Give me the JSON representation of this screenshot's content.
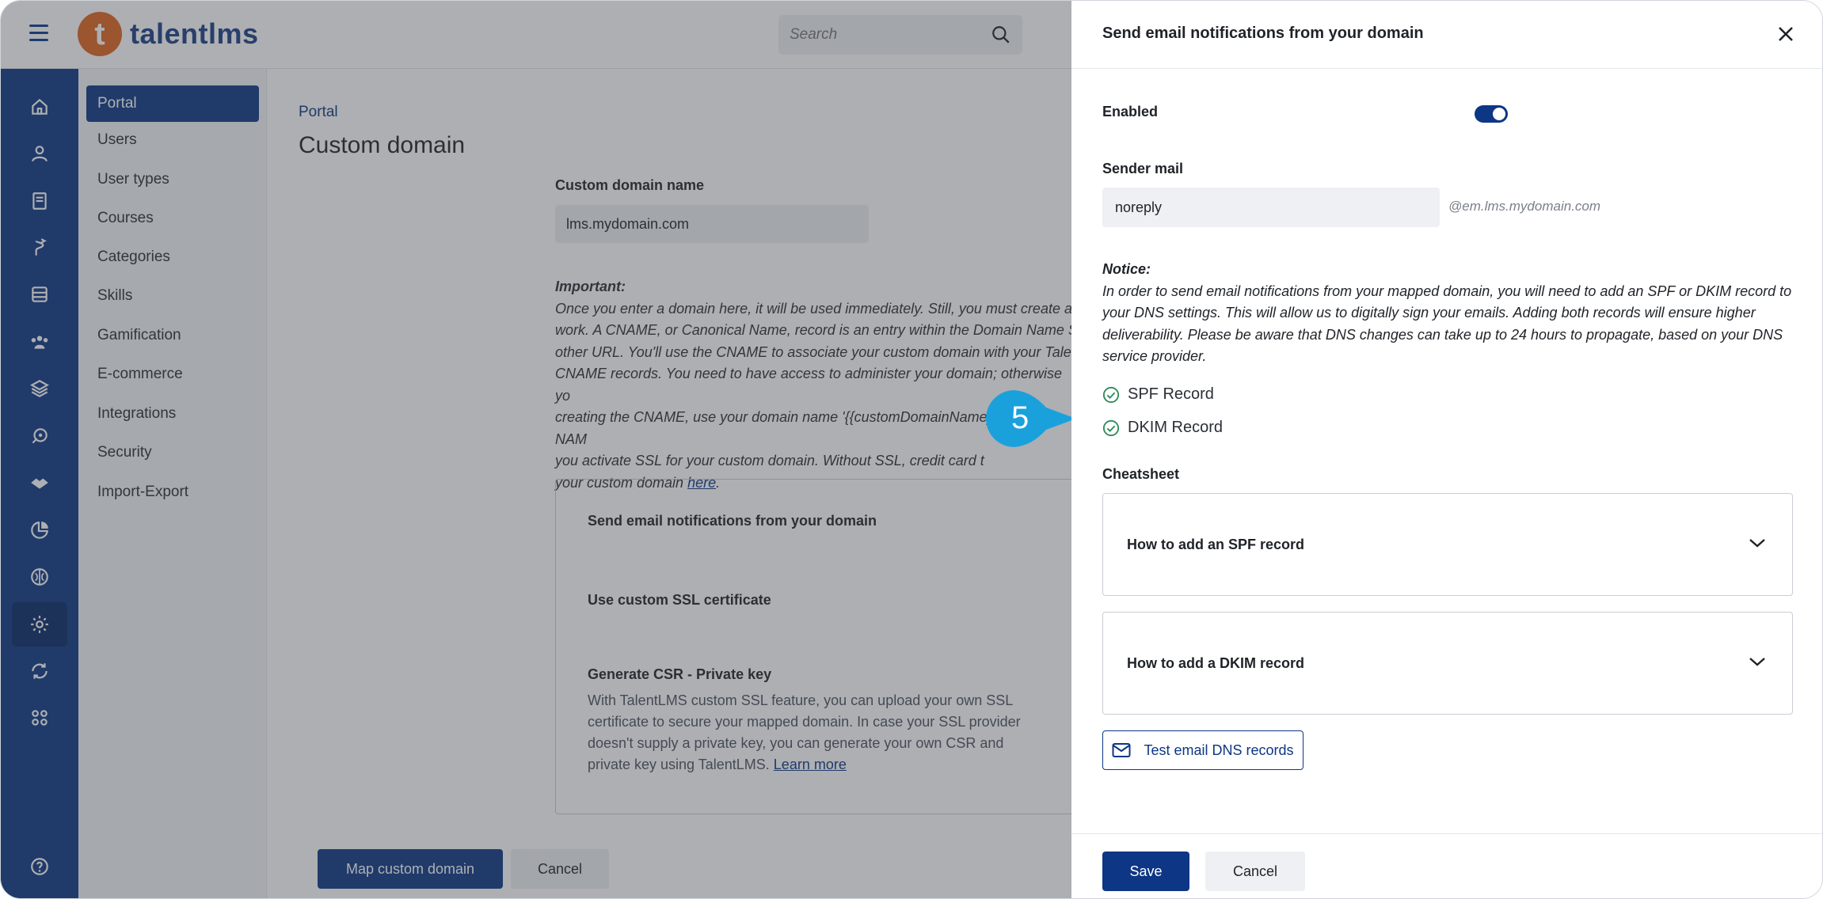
{
  "app": {
    "logo_letter": "t",
    "logo_text": "talentlms"
  },
  "search": {
    "placeholder": "Search"
  },
  "rail": {
    "icons": [
      "home-icon",
      "user-icon",
      "book-icon",
      "path-icon",
      "archive-icon",
      "users-icon",
      "layers-icon",
      "rocket-icon",
      "handshake-icon",
      "pie-chart-icon",
      "brain-icon",
      "gear-icon",
      "sync-icon",
      "apps-icon",
      "help-icon"
    ],
    "active": "gear-icon"
  },
  "subnav": {
    "items": [
      {
        "label": "Portal"
      },
      {
        "label": "Users"
      },
      {
        "label": "User types"
      },
      {
        "label": "Courses"
      },
      {
        "label": "Categories"
      },
      {
        "label": "Skills"
      },
      {
        "label": "Gamification"
      },
      {
        "label": "E-commerce"
      },
      {
        "label": "Integrations"
      },
      {
        "label": "Security"
      },
      {
        "label": "Import-Export"
      }
    ]
  },
  "main": {
    "breadcrumb": "Portal",
    "title": "Custom domain",
    "domain_label": "Custom domain name",
    "domain_value": "lms.mydomain.com",
    "important_title": "Important:",
    "important_lines": [
      "Once you enter a domain here, it will be used immediately. Still, you must create a",
      "work. A CNAME, or Canonical Name, record is an entry within the Domain Name S",
      "other URL. You'll use the CNAME to associate your custom domain with your Taler",
      "CNAME records. You need to have access to administer your domain; otherwise yo",
      "creating the CNAME, use your domain name '{{customDomainName}}' as the NAM",
      "you activate SSL for your custom domain. Without SSL, credit card t",
      "your custom domain "
    ],
    "important_link": "here",
    "card": {
      "line1": "Send email notifications from your domain",
      "line2": "Use custom SSL certificate",
      "line3": "Generate CSR - Private key",
      "desc": "With TalentLMS custom SSL feature, you can upload your own SSL certificate to secure your mapped domain. In case your SSL provider doesn't supply a private key, you can generate your own CSR and private key using TalentLMS. ",
      "desc_link": "Learn more"
    },
    "map_button": "Map custom domain",
    "cancel_button": "Cancel"
  },
  "callout": {
    "number": "5"
  },
  "drawer": {
    "title": "Send email notifications from your domain",
    "enabled_label": "Enabled",
    "enabled": true,
    "sender_label": "Sender mail",
    "sender_value": "noreply",
    "sender_suffix": "@em.lms.mydomain.com",
    "notice_title": "Notice:",
    "notice_text": "In order to send email notifications from your mapped domain, you will need to add an SPF or DKIM record to your DNS settings. This will allow us to digitally sign your emails. Adding both records will ensure higher deliverability. Please be aware that DNS changes can take up to 24 hours to propagate, based on your DNS service provider.",
    "records": [
      {
        "label": "SPF Record"
      },
      {
        "label": "DKIM Record"
      }
    ],
    "cheatsheet_label": "Cheatsheet",
    "accordions": [
      {
        "label": "How to add an SPF record"
      },
      {
        "label": "How to add a DKIM record"
      }
    ],
    "test_button": "Test email DNS records",
    "save_button": "Save",
    "cancel_button": "Cancel"
  },
  "colors": {
    "brand": "#0d3684",
    "logo": "#e0651e",
    "success": "#2e8b57"
  }
}
